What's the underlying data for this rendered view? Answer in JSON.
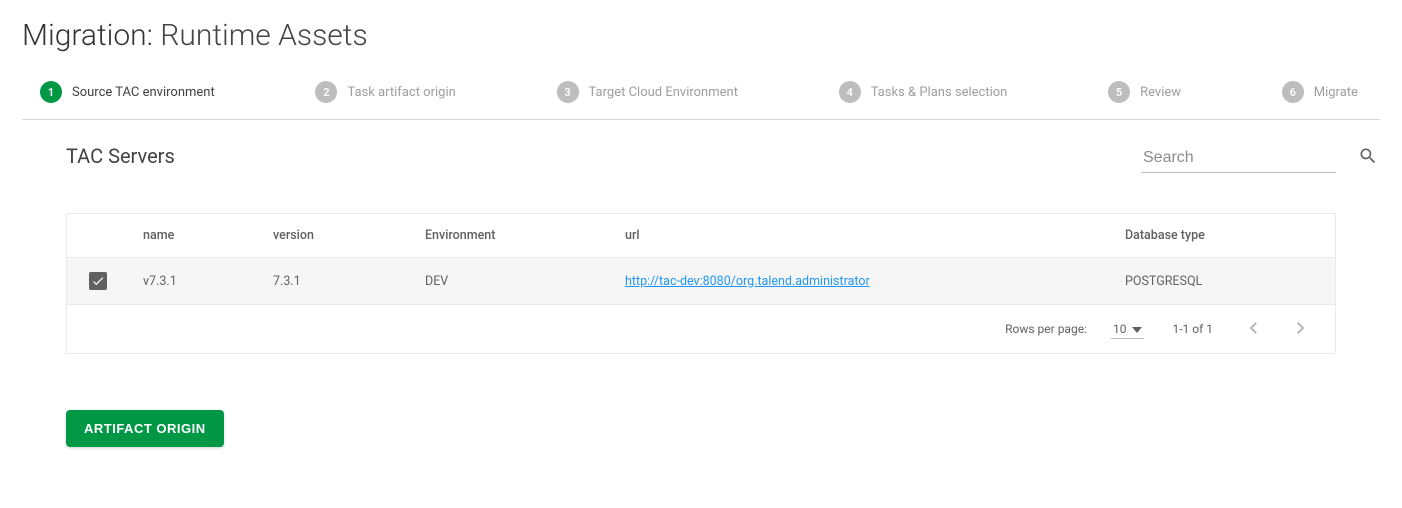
{
  "header": {
    "title_prefix": "Migration:",
    "title_suffix": "Runtime Assets"
  },
  "stepper": {
    "steps": [
      {
        "num": "1",
        "label": "Source TAC environment",
        "active": true
      },
      {
        "num": "2",
        "label": "Task artifact origin",
        "active": false
      },
      {
        "num": "3",
        "label": "Target Cloud Environment",
        "active": false
      },
      {
        "num": "4",
        "label": "Tasks & Plans selection",
        "active": false
      },
      {
        "num": "5",
        "label": "Review",
        "active": false
      },
      {
        "num": "6",
        "label": "Migrate",
        "active": false
      }
    ]
  },
  "section": {
    "title": "TAC Servers",
    "search_placeholder": "Search"
  },
  "table": {
    "columns": {
      "name": "name",
      "version": "version",
      "environment": "Environment",
      "url": "url",
      "database_type": "Database type"
    },
    "rows": [
      {
        "checked": true,
        "name": "v7.3.1",
        "version": "7.3.1",
        "environment": "DEV",
        "url": "http://tac-dev:8080/org.talend.administrator",
        "database_type": "POSTGRESQL"
      }
    ],
    "footer": {
      "rows_per_page_label": "Rows per page:",
      "rows_per_page_value": "10",
      "range_text": "1-1 of 1"
    }
  },
  "actions": {
    "artifact_origin": "ARTIFACT ORIGIN"
  }
}
